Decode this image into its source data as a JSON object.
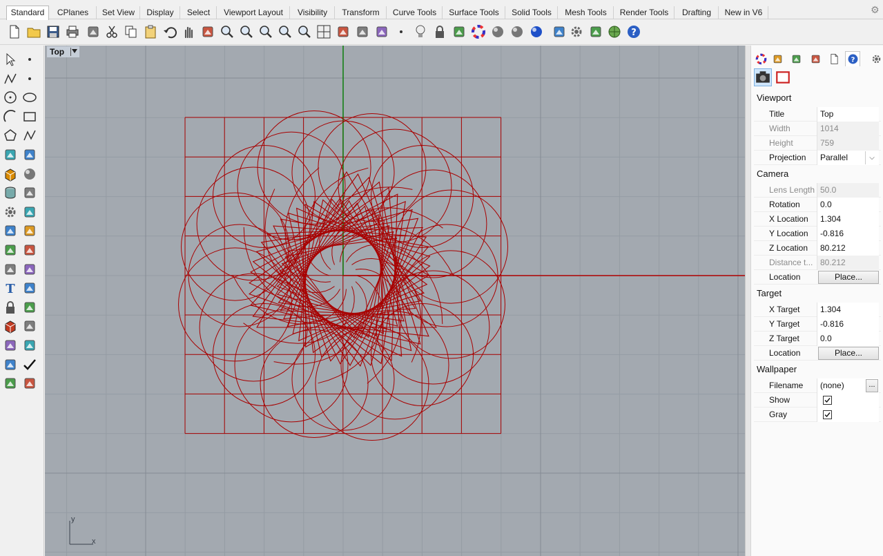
{
  "tabs": [
    {
      "label": "Standard",
      "active": true
    },
    {
      "label": "CPlanes"
    },
    {
      "label": "Set View"
    },
    {
      "label": "Display"
    },
    {
      "label": "Select"
    },
    {
      "label": "Viewport Layout"
    },
    {
      "label": "Visibility"
    },
    {
      "label": "Transform"
    },
    {
      "label": "Curve Tools"
    },
    {
      "label": "Surface Tools"
    },
    {
      "label": "Solid Tools"
    },
    {
      "label": "Mesh Tools"
    },
    {
      "label": "Render Tools"
    },
    {
      "label": "Drafting"
    },
    {
      "label": "New in V6"
    }
  ],
  "toolbar_icons": [
    "new-file-icon",
    "open-folder-icon",
    "save-icon",
    "print-icon",
    "import-icon",
    "cut-icon",
    "copy-icon",
    "paste-icon",
    "undo-icon",
    "pan-hand-icon",
    "rotate-view-icon",
    "zoom-icon",
    "zoom-window-icon",
    "zoom-extents-icon",
    "zoom-selected-icon",
    "zoom-previous-icon",
    "four-viewports-icon",
    "car-icon",
    "paint-bucket-icon",
    "object-snap-icon",
    "move-point-icon",
    "light-bulb-icon",
    "lock-icon",
    "layer-icon",
    "color-wheel-icon",
    "shade-sphere-icon",
    "render-sphere-icon",
    "material-sphere-icon",
    "flashlight-icon",
    "settings-icon",
    "grips-icon",
    "globe-icon",
    "help-icon"
  ],
  "left_tool_icons": [
    "select-arrow-icon",
    "point-icon",
    "polyline-icon",
    "curve-point-icon",
    "circle-icon",
    "ellipse-icon",
    "arc-icon",
    "rectangle-icon",
    "polygon-icon",
    "freeform-curve-icon",
    "surface-corner-icon",
    "extrude-surface-icon",
    "box-solid-icon",
    "sphere-solid-icon",
    "cylinder-icon",
    "mesh-plane-icon",
    "boolean-gear-icon",
    "explode-icon",
    "trim-icon",
    "split-icon",
    "boolean-union-icon",
    "group-icon",
    "fillet-icon",
    "chamfer-icon",
    "text-icon",
    "dimension-icon",
    "block-icon",
    "transform-icon",
    "solid-box-icon",
    "hatch-icon",
    "array-icon",
    "align-icon",
    "sweep-icon",
    "check-icon",
    "rotate-solid-icon",
    "paint-icon"
  ],
  "viewport": {
    "title": "Top",
    "axis_y": "y",
    "axis_x": "x"
  },
  "panel_tab_icons": [
    "color-properties-icon",
    "layers-panel-icon",
    "render-panel-icon",
    "display-panel-icon",
    "files-panel-icon",
    "help-panel-icon",
    "gear-icon"
  ],
  "panel_subtab_icons": [
    "camera-icon",
    "viewport-frame-icon"
  ],
  "panel": {
    "viewport": {
      "title": "Viewport",
      "rows": [
        {
          "label": "Title",
          "value": "Top"
        },
        {
          "label": "Width",
          "value": "1014",
          "disabled": true
        },
        {
          "label": "Height",
          "value": "759",
          "disabled": true
        },
        {
          "label": "Projection",
          "value": "Parallel",
          "type": "select"
        }
      ]
    },
    "camera": {
      "title": "Camera",
      "rows": [
        {
          "label": "Lens Length",
          "value": "50.0",
          "disabled": true
        },
        {
          "label": "Rotation",
          "value": "0.0"
        },
        {
          "label": "X Location",
          "value": "1.304"
        },
        {
          "label": "Y Location",
          "value": "-0.816"
        },
        {
          "label": "Z Location",
          "value": "80.212"
        },
        {
          "label": "Distance t...",
          "value": "80.212",
          "disabled": true
        },
        {
          "label": "Location",
          "value": "Place...",
          "type": "button"
        }
      ]
    },
    "target": {
      "title": "Target",
      "rows": [
        {
          "label": "X Target",
          "value": "1.304"
        },
        {
          "label": "Y Target",
          "value": "-0.816"
        },
        {
          "label": "Z Target",
          "value": "0.0"
        },
        {
          "label": "Location",
          "value": "Place...",
          "type": "button"
        }
      ]
    },
    "wallpaper": {
      "title": "Wallpaper",
      "filename_label": "Filename",
      "filename_value": "(none)",
      "filename_button": "...",
      "show_label": "Show",
      "show_checked": true,
      "gray_label": "Gray",
      "gray_checked": true
    }
  },
  "colors": {
    "viewport_bg": "#a3a9b0",
    "grid_minor": "#959ca4",
    "grid_major": "#848b94",
    "geometry": "#a80000",
    "x_axis": "#b00000",
    "y_axis": "#007a00"
  }
}
